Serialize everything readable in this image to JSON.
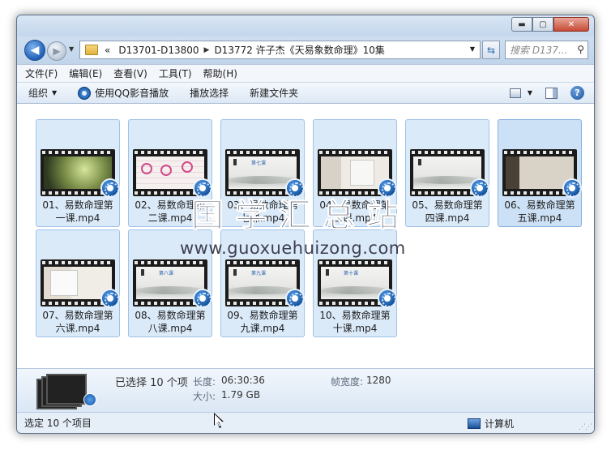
{
  "window": {
    "buttons": {
      "minimize": "▬",
      "maximize": "▢",
      "close": "✕"
    }
  },
  "address": {
    "chevron": "«",
    "segments": [
      "D13701-D13800",
      "D13772 许子杰《天易象数命理》10集"
    ],
    "search_placeholder": "搜索 D137..."
  },
  "menu": [
    "文件(F)",
    "编辑(E)",
    "查看(V)",
    "工具(T)",
    "帮助(H)"
  ],
  "toolbar": {
    "organize": "组织",
    "play_with": "使用QQ影音播放",
    "play_selection": "播放选择",
    "new_folder": "新建文件夹"
  },
  "files": [
    {
      "name": "01、易数命理第一课.mp4",
      "thumb": "green"
    },
    {
      "name": "02、易数命理第二课.mp4",
      "thumb": "diagram"
    },
    {
      "name": "03、易数命理第七课.mp4",
      "thumb": "ink"
    },
    {
      "name": "04、易数命理第三课.mp4",
      "thumb": "wall"
    },
    {
      "name": "05、易数命理第四课.mp4",
      "thumb": "ink"
    },
    {
      "name": "06、易数命理第五课.mp4",
      "thumb": "dark"
    },
    {
      "name": "07、易数命理第六课.mp4",
      "thumb": "wall2"
    },
    {
      "name": "08、易数命理第八课.mp4",
      "thumb": "ink"
    },
    {
      "name": "09、易数命理第九课.mp4",
      "thumb": "ink"
    },
    {
      "name": "10、易数命理第十课.mp4",
      "thumb": "ink"
    }
  ],
  "thumb_titles": {
    "t3": "第七课",
    "t8": "第八课",
    "t9": "第九课",
    "t10": "第十课"
  },
  "watermark": {
    "cn": "国学汇总站",
    "url": "www.guoxuehuizong.com"
  },
  "details": {
    "selected": "已选择 10 个项",
    "length_label": "长度:",
    "length_value": "06:30:36",
    "size_label": "大小:",
    "size_value": "1.79 GB",
    "framewidth_label": "帧宽度:",
    "framewidth_value": "1280"
  },
  "status": {
    "left": "选定 10 个项目",
    "right": "计算机"
  },
  "colors": {
    "accent": "#1f5fb8",
    "tile_bg": "#dbeaf9",
    "tile_border": "#9fc2e8"
  }
}
